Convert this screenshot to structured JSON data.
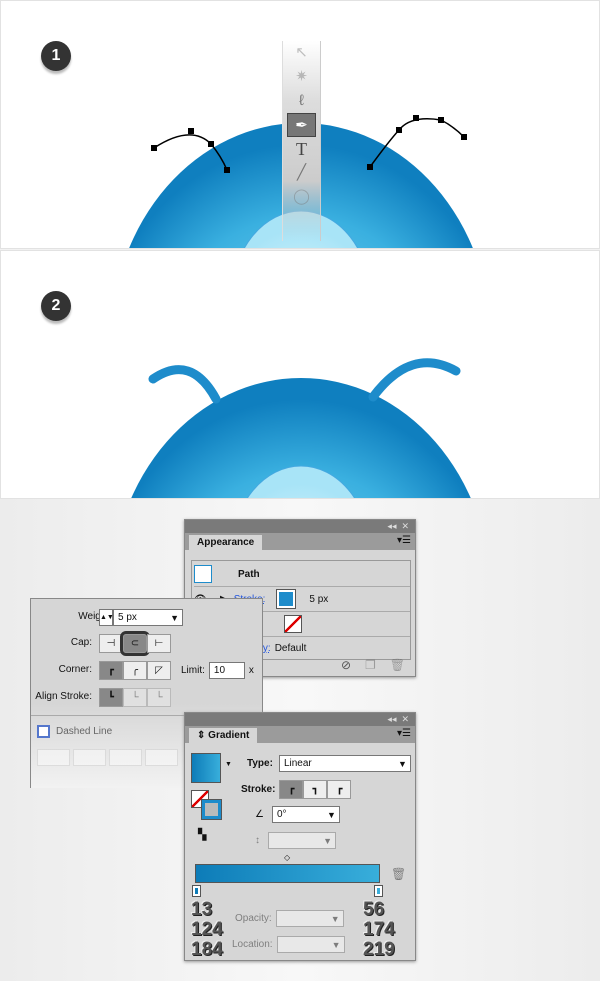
{
  "steps": [
    {
      "number": "1"
    },
    {
      "number": "2"
    }
  ],
  "colors": {
    "blob_outer": "#0f7fbf",
    "blob_inner": "#7fd3f2",
    "highlight": "#e8fbff",
    "antenna": "#1e8ccb",
    "gradient_start": "#0d7cb8",
    "gradient_end": "#38aedb"
  },
  "toolbar": {
    "tools": [
      "selection-tool",
      "magic-wand-tool",
      "lasso-tool",
      "pen-tool",
      "type-tool",
      "line-tool",
      "ellipse-tool"
    ],
    "selected": "pen-tool",
    "type_glyph": "T"
  },
  "appearance": {
    "title": "Appearance",
    "path_label": "Path",
    "stroke_label": "Stroke:",
    "stroke_weight": "5 px",
    "opacity_label": "Opacity:",
    "opacity_value": "Default"
  },
  "stroke": {
    "weight_label": "Weight:",
    "weight_value": "5 px",
    "cap_label": "Cap:",
    "cap_selected": "round",
    "corner_label": "Corner:",
    "limit_label": "Limit:",
    "limit_value": "10",
    "limit_unit": "x",
    "align_label": "Align Stroke:",
    "dashed_label": "Dashed Line"
  },
  "gradient": {
    "title": "Gradient",
    "type_label": "Type:",
    "type_value": "Linear",
    "stroke_label": "Stroke:",
    "angle_value": "0°",
    "opacity_label": "Opacity:",
    "location_label": "Location:",
    "stop_left": {
      "r": "13",
      "g": "124",
      "b": "184"
    },
    "stop_right": {
      "r": "56",
      "g": "174",
      "b": "219"
    }
  }
}
